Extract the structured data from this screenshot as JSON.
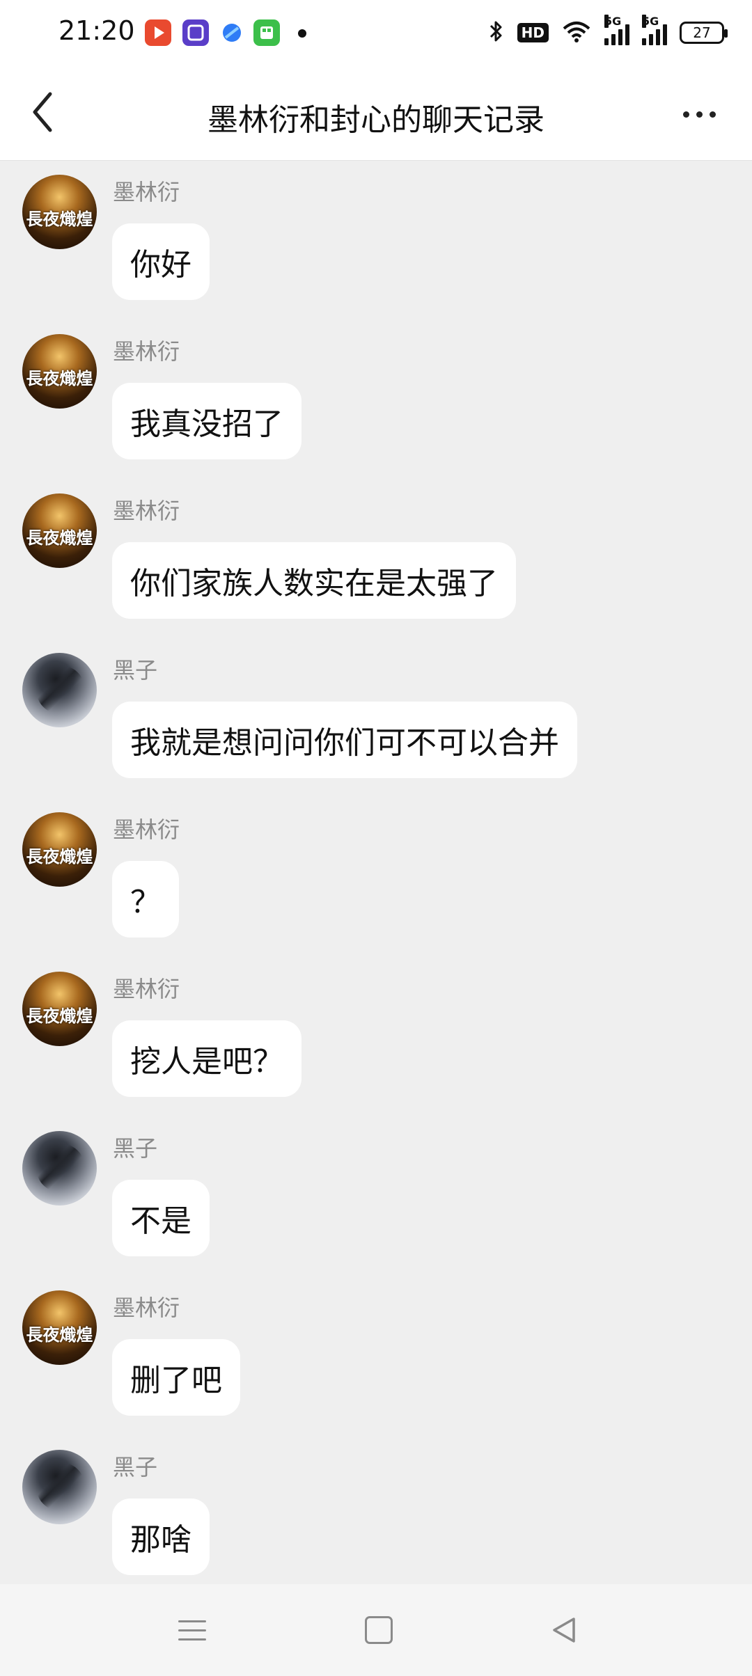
{
  "status_bar": {
    "time": "21:20",
    "notification_icons": [
      "video-app-icon",
      "tieba-app-icon",
      "browser-app-icon",
      "calculator-app-icon"
    ],
    "hd_label": "HD",
    "network_1": "5G",
    "network_2": "5G",
    "battery": "27"
  },
  "header": {
    "title": "墨林衍和封心的聊天记录",
    "back_icon": "chevron-left-icon",
    "more_icon": "more-dots-icon"
  },
  "messages": [
    {
      "sender": "墨林衍",
      "text": "你好",
      "avatar": "golden-warrior-avatar"
    },
    {
      "sender": "墨林衍",
      "text": "我真没招了",
      "avatar": "golden-warrior-avatar"
    },
    {
      "sender": "墨林衍",
      "text": "你们家族人数实在是太强了",
      "avatar": "golden-warrior-avatar"
    },
    {
      "sender": "黑子",
      "text": "我就是想问问你们可不可以合并",
      "avatar": "dark-figure-avatar"
    },
    {
      "sender": "墨林衍",
      "text": "？",
      "avatar": "golden-warrior-avatar"
    },
    {
      "sender": "墨林衍",
      "text": "挖人是吧？",
      "avatar": "golden-warrior-avatar"
    },
    {
      "sender": "黑子",
      "text": "不是",
      "avatar": "dark-figure-avatar"
    },
    {
      "sender": "墨林衍",
      "text": "删了吧",
      "avatar": "golden-warrior-avatar"
    },
    {
      "sender": "黑子",
      "text": "那啥",
      "avatar": "dark-figure-avatar"
    }
  ],
  "avatar_text": "長夜熾煌",
  "nav_bar": {
    "menu_icon": "menu-icon",
    "home_icon": "home-icon",
    "back_icon": "back-triangle-icon"
  }
}
